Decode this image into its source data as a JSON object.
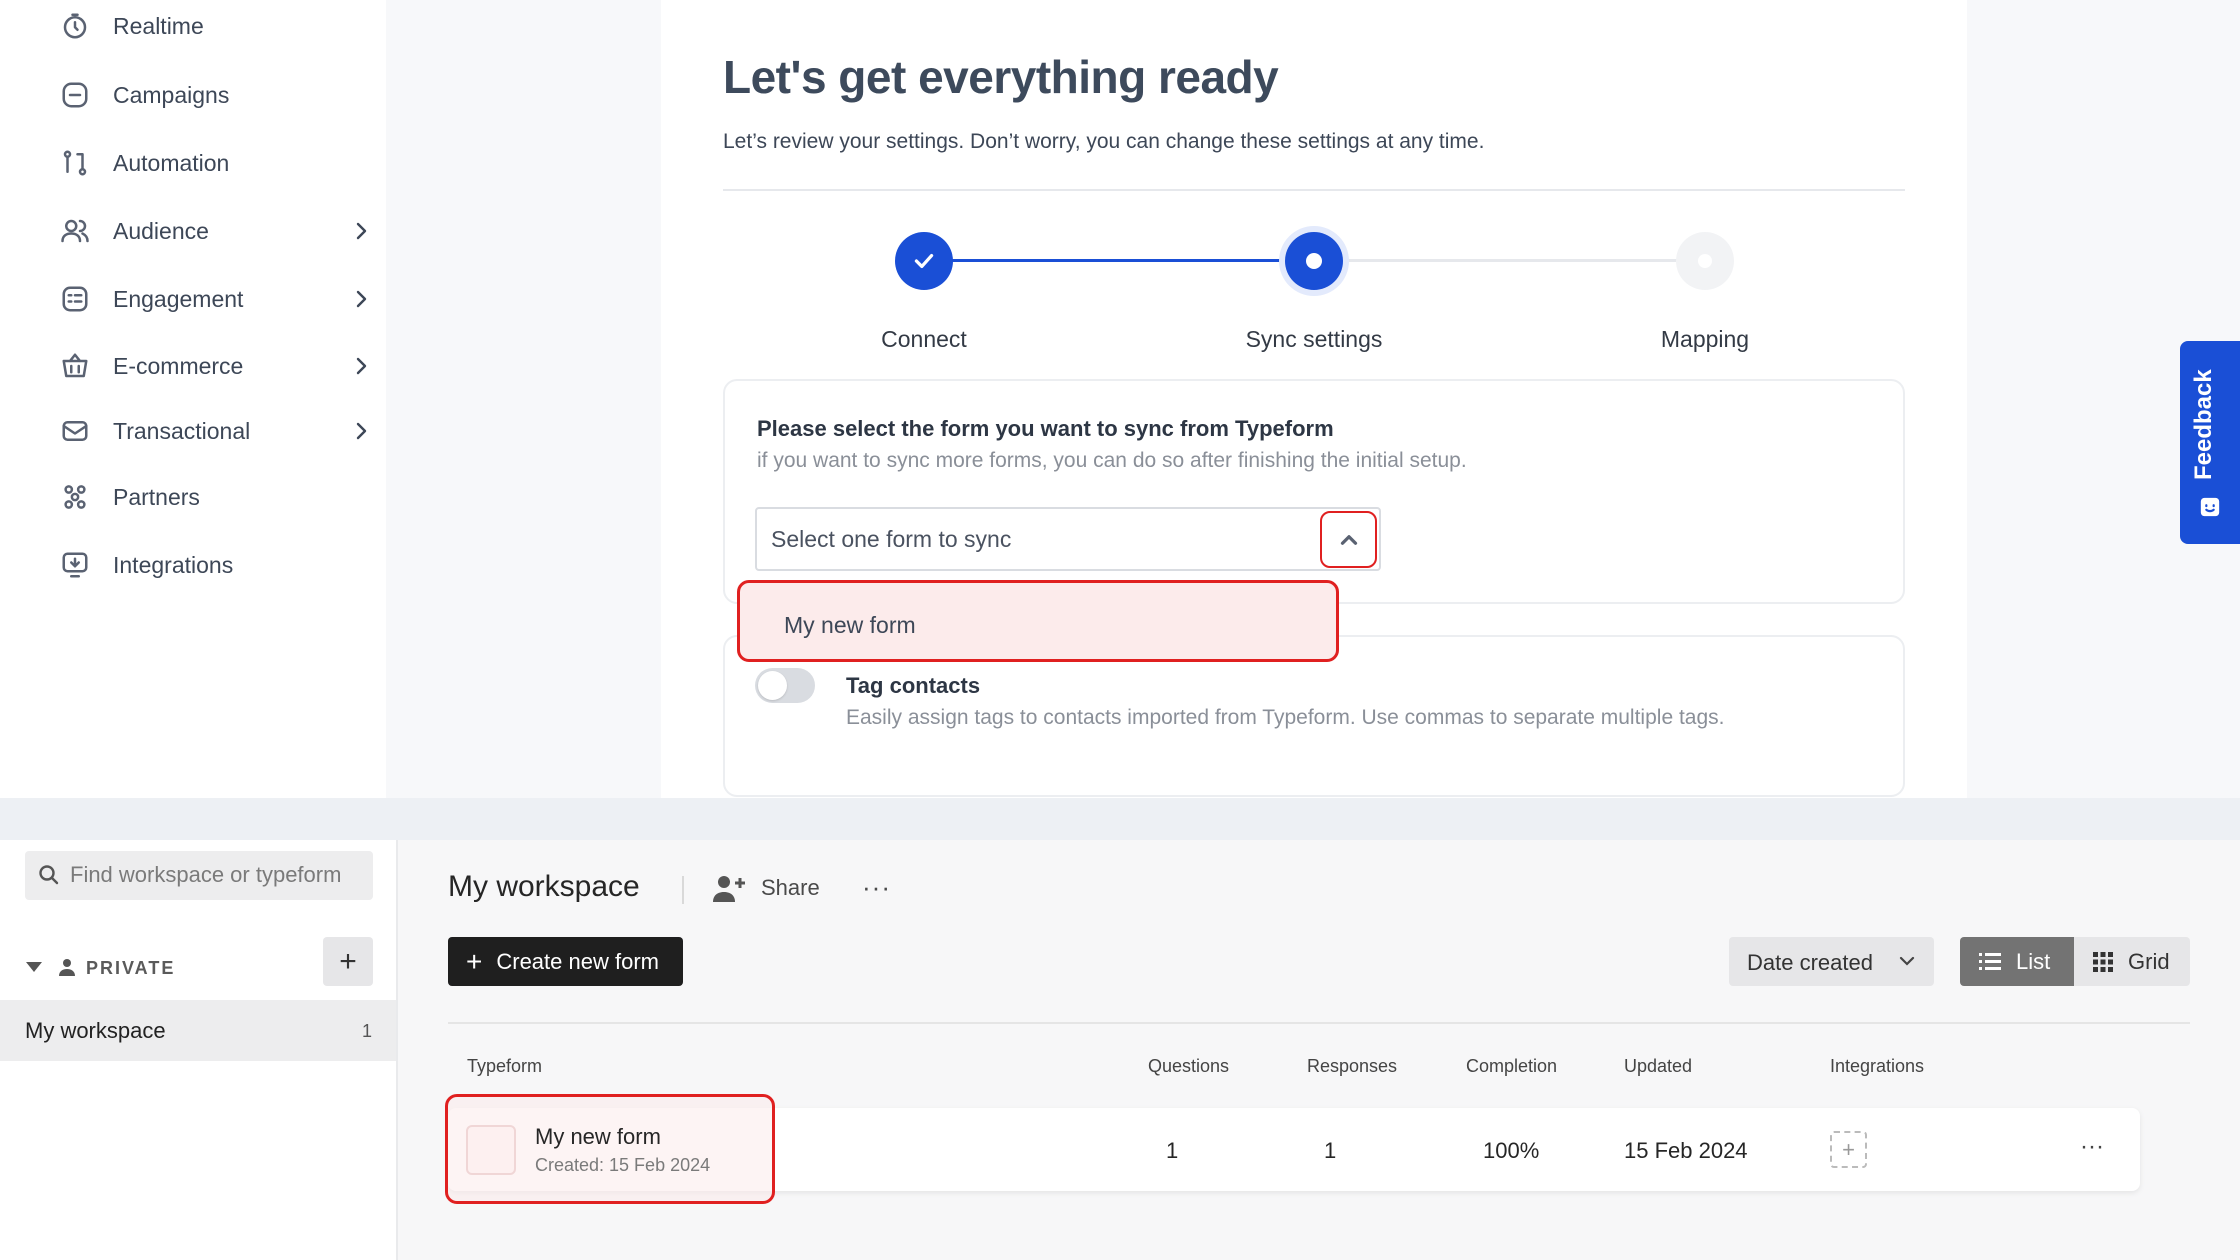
{
  "sidebar": {
    "items": [
      {
        "label": "Realtime",
        "icon": "stopwatch-icon",
        "chevron": false
      },
      {
        "label": "Campaigns",
        "icon": "campaigns-icon",
        "chevron": false
      },
      {
        "label": "Automation",
        "icon": "automation-icon",
        "chevron": false
      },
      {
        "label": "Audience",
        "icon": "audience-icon",
        "chevron": true
      },
      {
        "label": "Engagement",
        "icon": "engagement-icon",
        "chevron": true
      },
      {
        "label": "E-commerce",
        "icon": "basket-icon",
        "chevron": true
      },
      {
        "label": "Transactional",
        "icon": "envelope-icon",
        "chevron": true
      },
      {
        "label": "Partners",
        "icon": "partners-icon",
        "chevron": false
      },
      {
        "label": "Integrations",
        "icon": "integrations-icon",
        "chevron": false
      }
    ]
  },
  "setup": {
    "title": "Let's get everything ready",
    "subtitle": "Let’s review your settings. Don’t worry, you can change these settings at any time.",
    "steps": [
      {
        "label": "Connect",
        "state": "done"
      },
      {
        "label": "Sync settings",
        "state": "active"
      },
      {
        "label": "Mapping",
        "state": "pending"
      }
    ],
    "form_select": {
      "title": "Please select the form you want to sync from Typeform",
      "help": "if you want to sync more forms, you can do so after finishing the initial setup.",
      "placeholder": "Select one form to sync",
      "options": [
        "My new form"
      ]
    },
    "tag_contacts": {
      "title": "Tag contacts",
      "description": "Easily assign tags to contacts imported from Typeform. Use commas to separate multiple tags.",
      "enabled": false
    },
    "feedback_label": "Feedback"
  },
  "colors": {
    "accent": "#1a4fd6",
    "highlight": "#e02020"
  },
  "workspace": {
    "search_placeholder": "Find workspace or typeform",
    "section_label": "PRIVATE",
    "add_label": "+",
    "items": [
      {
        "label": "My workspace",
        "count": "1"
      }
    ],
    "title": "My workspace",
    "share_label": "Share",
    "more_label": "···",
    "create_label": "Create new form",
    "sort_label": "Date created",
    "view_list": "List",
    "view_grid": "Grid",
    "table": {
      "headers": [
        "Typeform",
        "Questions",
        "Responses",
        "Completion",
        "Updated",
        "Integrations"
      ],
      "rows": [
        {
          "name": "My new form",
          "created": "Created: 15 Feb 2024",
          "questions": "1",
          "responses": "1",
          "completion": "100%",
          "updated": "15 Feb 2024"
        }
      ]
    }
  }
}
